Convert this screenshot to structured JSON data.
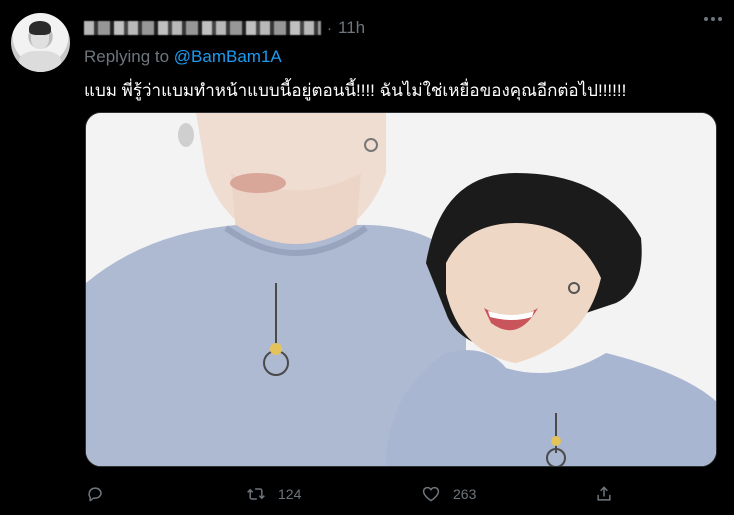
{
  "tweet": {
    "time": "11h",
    "dot": "·",
    "replying_prefix": "Replying to",
    "replying_handle": "@BamBam1A",
    "text": "แบม พี่รู้ว่าแบมทำหน้าแบบนี้อยู่ตอนนี้!!!! ฉันไม่ใช่เหยื่อของคุณอีกต่อไป!!!!!!",
    "actions": {
      "reply_count": "",
      "retweet_count": "124",
      "like_count": "263"
    }
  },
  "icons": {
    "more": "more-horizontal-icon",
    "reply": "reply-icon",
    "retweet": "retweet-icon",
    "like": "heart-icon",
    "share": "share-icon"
  },
  "colors": {
    "background": "#000000",
    "text": "#ffffff",
    "muted": "#6e767d",
    "link": "#1d9bf0"
  }
}
